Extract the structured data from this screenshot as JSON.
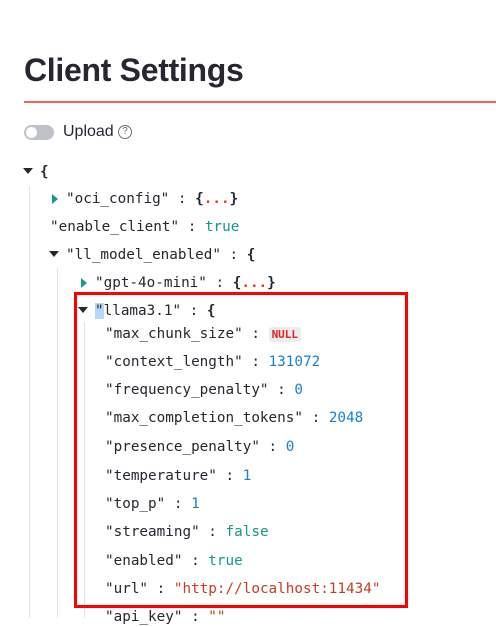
{
  "page": {
    "title": "Client Settings"
  },
  "upload": {
    "label": "Upload",
    "enabled": false,
    "help_icon": "question-circle-icon"
  },
  "colors": {
    "accent": "#ff4b4b",
    "highlight_box": "#ff0000",
    "bool": "#0e9a8c",
    "number": "#1a7fd0",
    "string": "#c2401f",
    "null": "#e8202a"
  },
  "tree": [
    {
      "key": "",
      "open": "{",
      "caret": "open",
      "depth": 0
    },
    {
      "key": "\"oci_config\"",
      "collapsed": "{...}",
      "caret": "closed",
      "depth": 1
    },
    {
      "key": "\"enable_client\"",
      "value": "true",
      "type": "bool",
      "depth": 1
    },
    {
      "key": "\"ll_model_enabled\"",
      "open": "{",
      "caret": "open",
      "depth": 1
    },
    {
      "key": "\"gpt-4o-mini\"",
      "collapsed": "{...}",
      "caret": "closed",
      "depth": 2
    },
    {
      "key": "\"llama3.1\"",
      "open": "{",
      "caret": "open",
      "depth": 2,
      "selected": true
    },
    {
      "key": "\"max_chunk_size\"",
      "value": "NULL",
      "type": "null",
      "depth": 3
    },
    {
      "key": "\"context_length\"",
      "value": "131072",
      "type": "num",
      "depth": 3
    },
    {
      "key": "\"frequency_penalty\"",
      "value": "0",
      "type": "num",
      "depth": 3
    },
    {
      "key": "\"max_completion_tokens\"",
      "value": "2048",
      "type": "num",
      "depth": 3
    },
    {
      "key": "\"presence_penalty\"",
      "value": "0",
      "type": "num",
      "depth": 3
    },
    {
      "key": "\"temperature\"",
      "value": "1",
      "type": "num",
      "depth": 3
    },
    {
      "key": "\"top_p\"",
      "value": "1",
      "type": "num",
      "depth": 3
    },
    {
      "key": "\"streaming\"",
      "value": "false",
      "type": "bool",
      "depth": 3
    },
    {
      "key": "\"enabled\"",
      "value": "true",
      "type": "bool",
      "depth": 3
    },
    {
      "key": "\"url\"",
      "value": "\"http://localhost:11434\"",
      "type": "str",
      "depth": 3
    },
    {
      "key": "\"api_key\"",
      "value": "\"\"",
      "type": "str",
      "depth": 3
    }
  ]
}
